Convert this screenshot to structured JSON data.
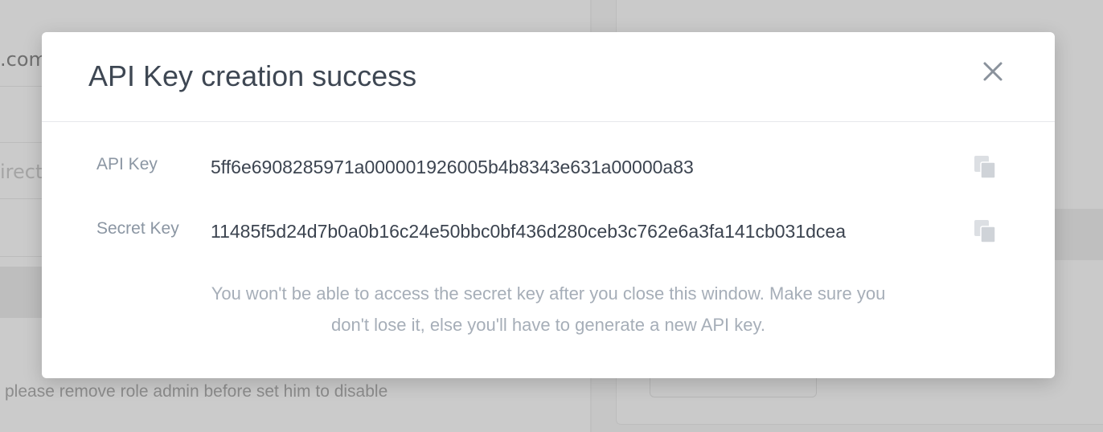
{
  "background": {
    "fields": [
      ".com",
      "",
      "irect",
      ""
    ],
    "hint": "please remove role admin before set him to disable"
  },
  "modal": {
    "title": "API Key creation success",
    "close_icon": "close-icon",
    "rows": [
      {
        "label": "API Key",
        "value": "5ff6e6908285971a000001926005b4b8343e631a00000a83",
        "action_icon": "copy-icon"
      },
      {
        "label": "Secret Key",
        "value": "11485f5d24d7b0a0b16c24e50bbc0bf436d280ceb3c762e6a3fa141cb031dcea",
        "action_icon": "copy-icon"
      }
    ],
    "warning_lines": [
      "You won't be able to access the secret key after you close this window. Make sure you",
      "don't lose it, else you'll have to generate a new API key."
    ]
  },
  "colors": {
    "title": "#3e4753",
    "label": "#8b96a3",
    "value": "#3c4450",
    "muted": "#a6aeb8",
    "icon": "#d4d7db"
  }
}
